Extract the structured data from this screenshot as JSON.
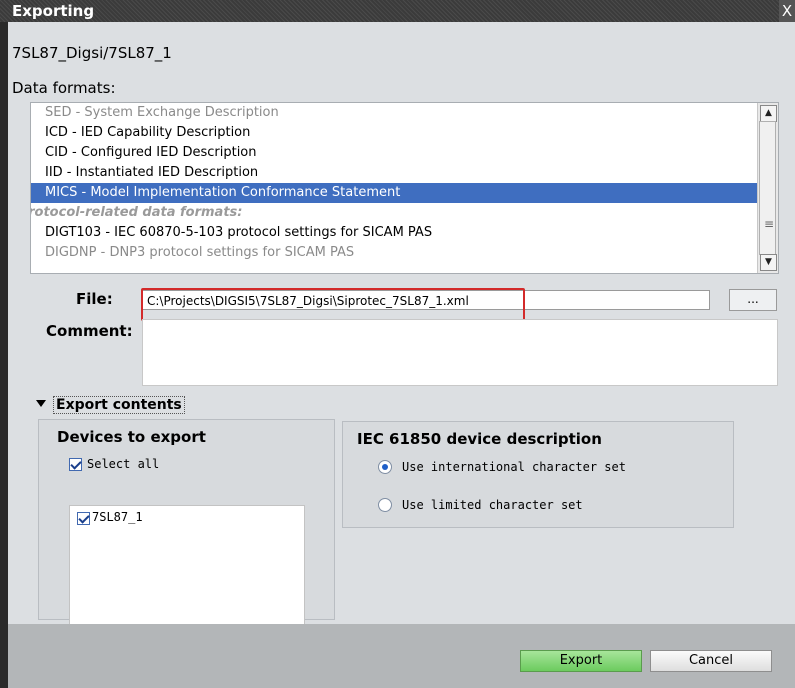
{
  "window": {
    "title": "Exporting",
    "close_glyph": "X"
  },
  "device_path": "7SL87_Digsi/7SL87_1",
  "data_formats": {
    "label": "Data formats:",
    "items": [
      {
        "text": "SED - System Exchange Description",
        "state": "dim"
      },
      {
        "text": "ICD - IED Capability Description",
        "state": "normal"
      },
      {
        "text": "CID - Configured IED Description",
        "state": "normal"
      },
      {
        "text": "IID - Instantiated IED Description",
        "state": "normal"
      },
      {
        "text": "MICS - Model Implementation Conformance Statement",
        "state": "selected"
      },
      {
        "text": "Protocol-related data formats:",
        "state": "group"
      },
      {
        "text": "DIGT103 - IEC 60870-5-103 protocol settings for SICAM PAS",
        "state": "normal"
      },
      {
        "text": "DIGDNP - DNP3 protocol settings for SICAM PAS",
        "state": "dim"
      }
    ],
    "scroll_up": "▲",
    "scroll_down": "▼",
    "scroll_grip": "≡"
  },
  "file": {
    "label": "File:",
    "value": "C:\\Projects\\DIGSI5\\7SL87_Digsi\\Siprotec_7SL87_1.xml",
    "browse_label": "..."
  },
  "comment": {
    "label": "Comment:",
    "value": ""
  },
  "export_contents": {
    "label": "Export contents",
    "devices": {
      "title": "Devices to export",
      "select_all": "Select all",
      "items": [
        "7SL87_1"
      ]
    },
    "iec": {
      "title": "IEC 61850 device description",
      "options": [
        "Use international character set",
        "Use limited character set"
      ],
      "selected_index": 0
    }
  },
  "buttons": {
    "export": "Export",
    "cancel": "Cancel"
  },
  "colors": {
    "selection": "#3f6ec0",
    "highlight_box": "#d32a2a",
    "export_button": "#8cd87c"
  }
}
